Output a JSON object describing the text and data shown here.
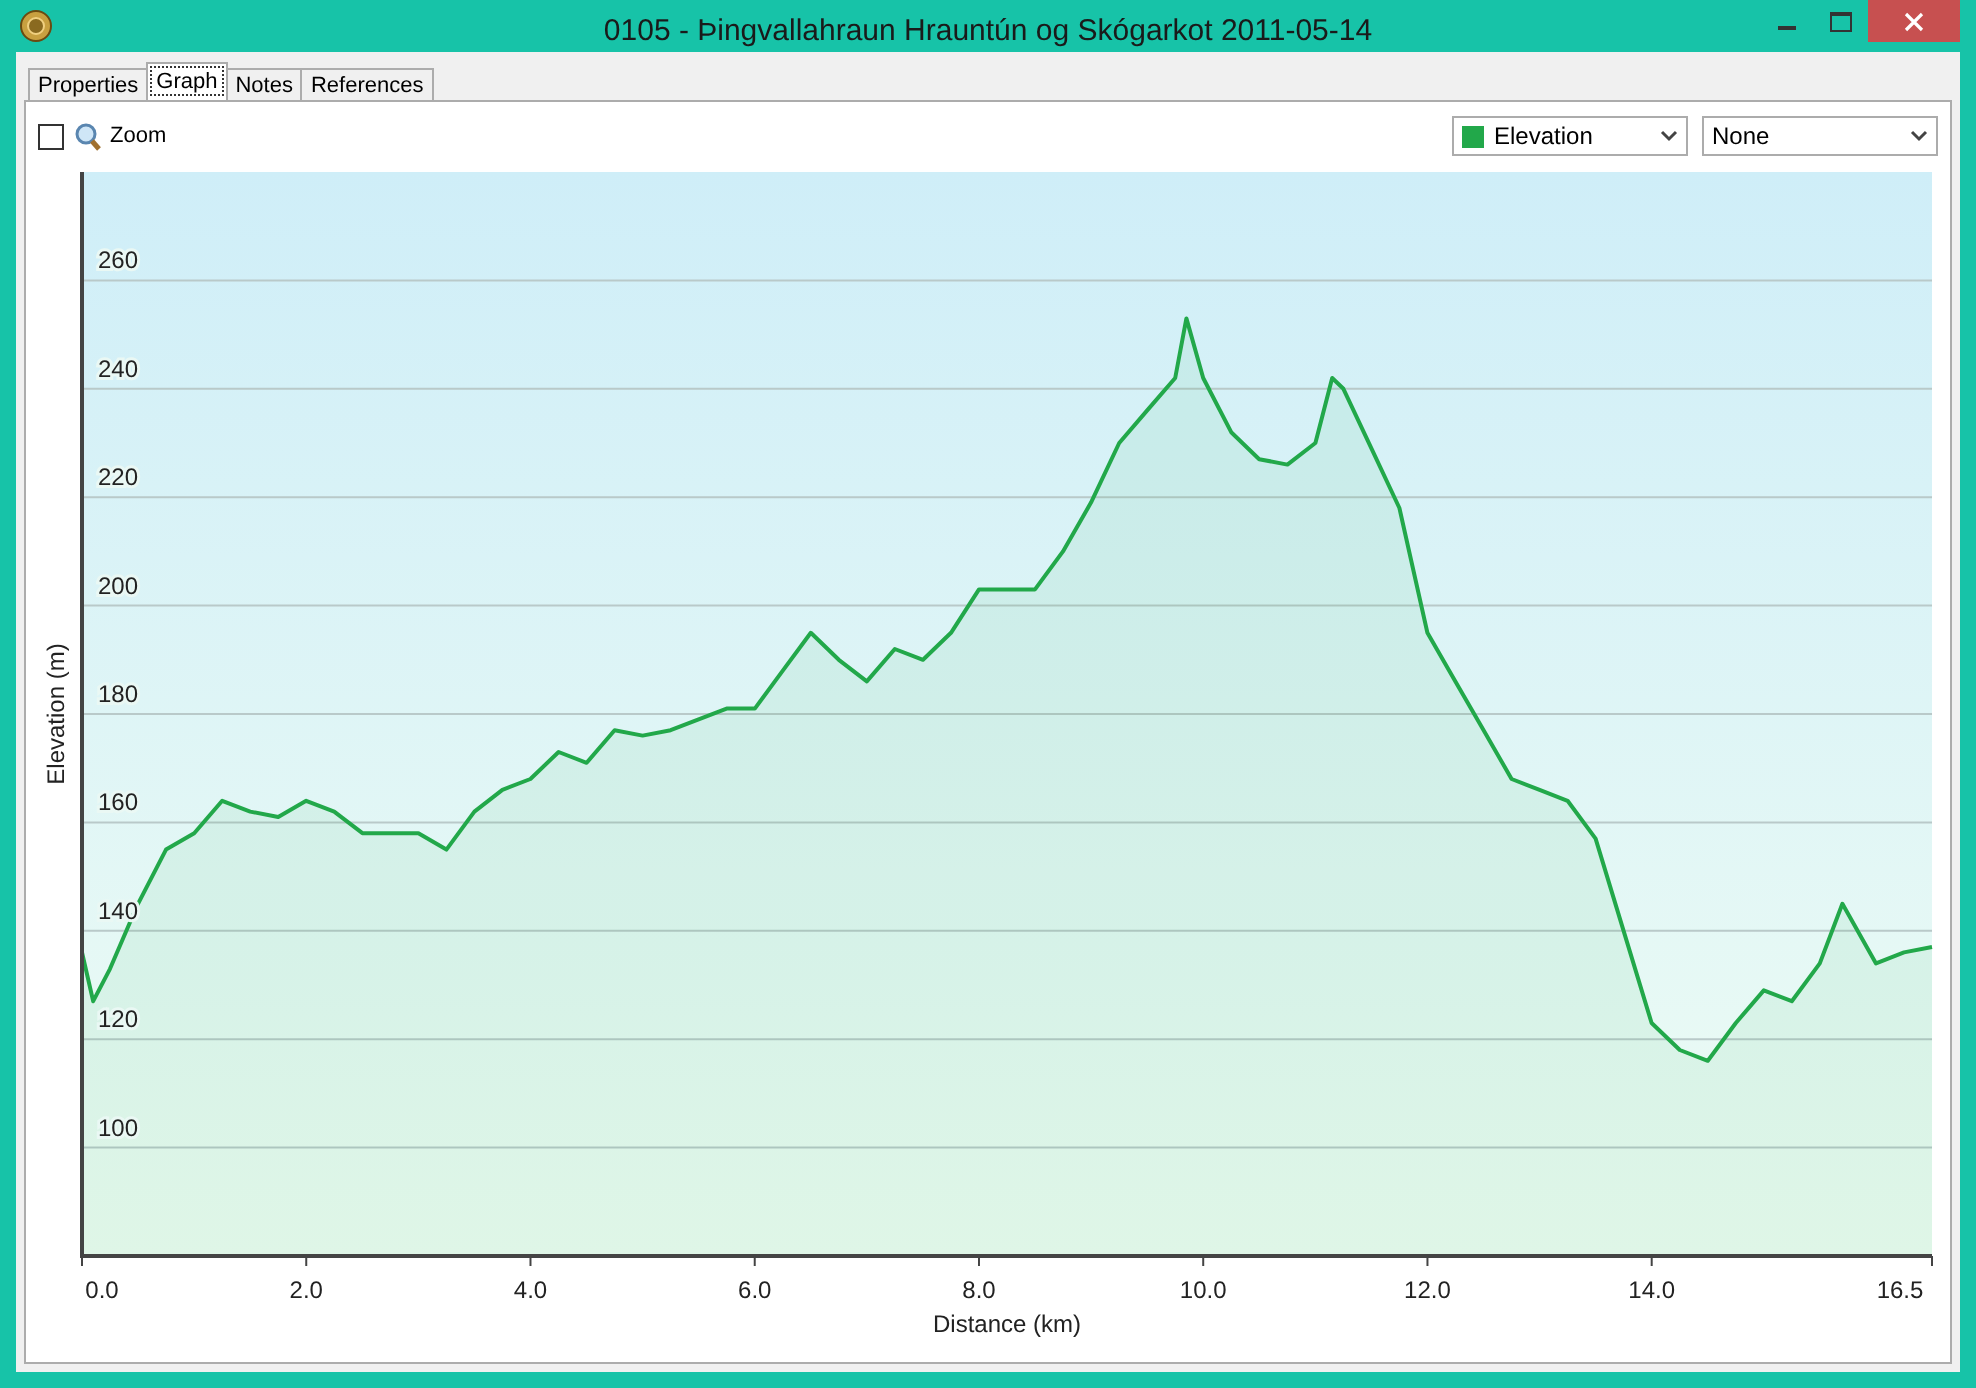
{
  "window": {
    "title": "0105 - Þingvallahraun Hrauntún og Skógarkot 2011-05-14"
  },
  "tabs": [
    {
      "label": "Properties",
      "selected": false
    },
    {
      "label": "Graph",
      "selected": true
    },
    {
      "label": "Notes",
      "selected": false
    },
    {
      "label": "References",
      "selected": false
    }
  ],
  "zoom": {
    "label": "Zoom",
    "checked": false
  },
  "dropdowns": [
    {
      "value": "None"
    }
  ],
  "chart_data": {
    "type": "area",
    "grid": true,
    "xlabel": "Distance  (km)",
    "ylabel": "Elevation (m)",
    "xlim": [
      0,
      16.5
    ],
    "ylim": [
      80,
      280
    ],
    "xticks": [
      {
        "value": 0,
        "label": "0.0"
      },
      {
        "value": 2,
        "label": "2.0"
      },
      {
        "value": 4,
        "label": "4.0"
      },
      {
        "value": 6,
        "label": "6.0"
      },
      {
        "value": 8,
        "label": "8.0"
      },
      {
        "value": 10,
        "label": "10.0"
      },
      {
        "value": 12,
        "label": "12.0"
      },
      {
        "value": 14,
        "label": "14.0"
      },
      {
        "value": 16.5,
        "label": "16.5"
      }
    ],
    "yticks": [
      100,
      120,
      140,
      160,
      180,
      200,
      220,
      240,
      260
    ],
    "x": [
      0,
      0.1,
      0.25,
      0.5,
      0.75,
      1,
      1.25,
      1.5,
      1.75,
      2,
      2.25,
      2.5,
      2.75,
      3,
      3.25,
      3.5,
      3.75,
      4,
      4.25,
      4.5,
      4.75,
      5,
      5.25,
      5.5,
      5.75,
      6,
      6.25,
      6.5,
      6.75,
      7,
      7.25,
      7.5,
      7.75,
      8,
      8.25,
      8.5,
      8.75,
      9,
      9.25,
      9.5,
      9.75,
      9.85,
      10,
      10.25,
      10.5,
      10.75,
      11,
      11.15,
      11.25,
      11.5,
      11.75,
      12,
      12.25,
      12.5,
      12.75,
      13,
      13.25,
      13.5,
      13.75,
      14,
      14.25,
      14.5,
      14.75,
      15,
      15.25,
      15.5,
      15.7,
      16,
      16.25,
      16.5
    ],
    "series": [
      {
        "name": "Elevation",
        "color": "#22a84a",
        "values": [
          136,
          127,
          133,
          145,
          155,
          158,
          164,
          162,
          161,
          164,
          162,
          158,
          158,
          158,
          155,
          162,
          166,
          168,
          173,
          171,
          177,
          176,
          177,
          179,
          181,
          181,
          188,
          195,
          190,
          186,
          192,
          190,
          195,
          203,
          203,
          203,
          210,
          219,
          230,
          236,
          242,
          253,
          242,
          232,
          227,
          226,
          230,
          242,
          240,
          229,
          218,
          195,
          186,
          177,
          168,
          166,
          164,
          157,
          140,
          123,
          118,
          116,
          123,
          129,
          127,
          134,
          145,
          134,
          136,
          137
        ]
      }
    ]
  }
}
